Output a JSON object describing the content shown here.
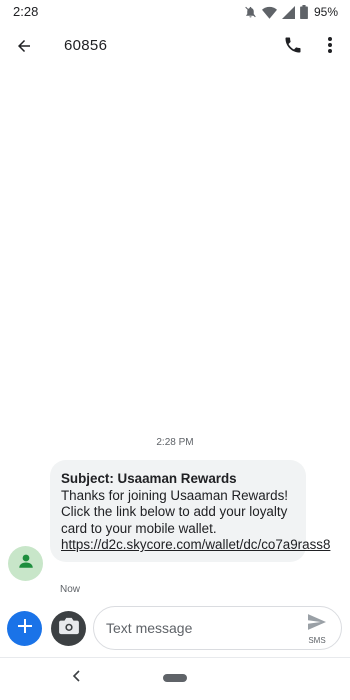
{
  "status_bar": {
    "time": "2:28",
    "battery": "95%",
    "icons": [
      "notifications-off-icon",
      "wifi-icon",
      "cellular-signal-icon",
      "battery-icon"
    ]
  },
  "app_bar": {
    "title": "60856",
    "icons": [
      "back-arrow-icon",
      "phone-icon",
      "more-vert-icon"
    ]
  },
  "conversation": {
    "timestamp": "2:28 PM",
    "message": {
      "subject": "Subject: Usaaman Rewards",
      "body": "Thanks for joining Usaaman Rewards! Click the link below to add your loyalty card to your mobile wallet.",
      "link": "https://d2c.skycore.com/wallet/dc/co7a9rass8",
      "time": "Now"
    },
    "avatar_icon": "person-icon"
  },
  "compose": {
    "placeholder": "Text message",
    "send_label": "SMS",
    "icons": [
      "add-icon",
      "camera-icon",
      "send-icon"
    ]
  },
  "nav": {
    "icons": [
      "nav-back-icon",
      "nav-home-pill"
    ]
  },
  "colors": {
    "accent": "#1a73e8",
    "bubble": "#f1f3f4",
    "avatar_bg": "#c8e6c9",
    "avatar_fg": "#1e8e3e",
    "text": "#202124",
    "secondary_text": "#5f6368"
  }
}
